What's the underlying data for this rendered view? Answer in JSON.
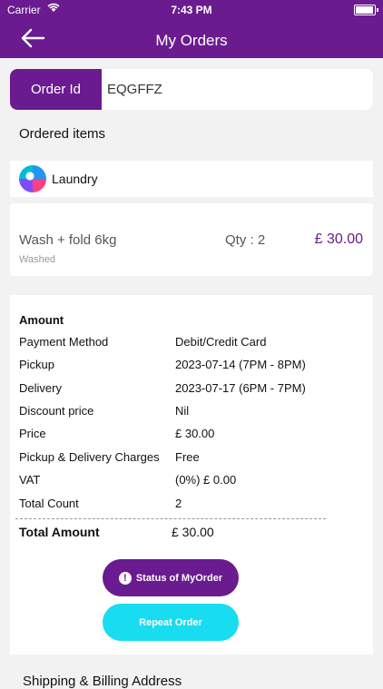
{
  "status_bar": {
    "carrier": "Carrier",
    "time": "7:43 PM"
  },
  "nav": {
    "title": "My Orders",
    "back_icon": "arrow-left-icon"
  },
  "order": {
    "id_label": "Order Id",
    "id_value": "EQGFFZ"
  },
  "ordered_items_heading": "Ordered items",
  "category": {
    "label": "Laundry"
  },
  "item": {
    "name": "Wash + fold 6kg",
    "qty": "Qty : 2",
    "price": "£ 30.00",
    "status": "Washed"
  },
  "amount": {
    "title": "Amount",
    "rows": [
      {
        "key": "Payment Method",
        "value": "Debit/Credit Card"
      },
      {
        "key": "Pickup",
        "value": "2023-07-14 (7PM - 8PM)"
      },
      {
        "key": "Delivery",
        "value": "2023-07-17 (6PM - 7PM)"
      },
      {
        "key": "Discount price",
        "value": "Nil"
      },
      {
        "key": "Price",
        "value": "£ 30.00"
      },
      {
        "key": "Pickup & Delivery Charges",
        "value": "Free"
      },
      {
        "key": "VAT",
        "value": "(0%) £ 0.00"
      },
      {
        "key": "Total Count",
        "value": "2"
      }
    ],
    "total_label": "Total Amount",
    "total_value": "£ 30.00"
  },
  "buttons": {
    "status": "Status of MyOrder",
    "status_icon_glyph": "!",
    "repeat": "Repeat Order"
  },
  "shipping_heading": "Shipping & Billing Address",
  "colors": {
    "brand": "#6a1b8f",
    "accent": "#18dcef",
    "background": "#f2f2f2"
  }
}
